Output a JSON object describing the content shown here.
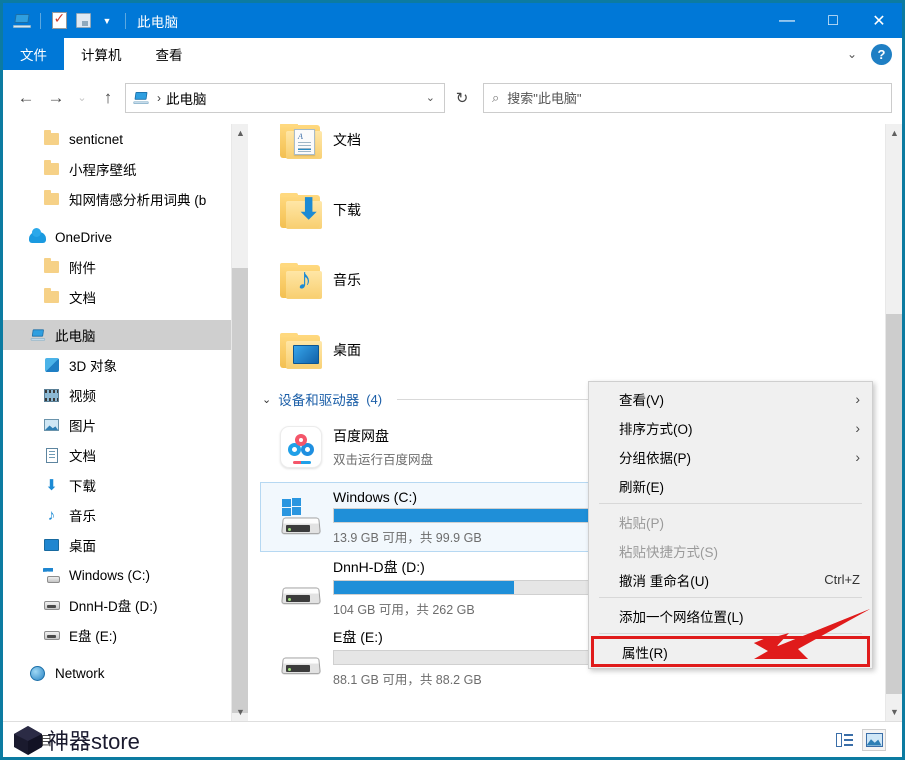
{
  "window": {
    "title": "此电脑",
    "quick_access": [
      {
        "name": "this-pc-icon",
        "label": "此电脑"
      },
      {
        "name": "properties-icon",
        "label": "属性"
      },
      {
        "name": "new-folder-icon",
        "label": "新建文件夹"
      },
      {
        "name": "customize-chevron-icon",
        "label": "自定义快速访问工具栏"
      }
    ],
    "controls": {
      "minimize": "—",
      "maximize": "□",
      "close": "✕"
    }
  },
  "ribbon": {
    "tabs": [
      {
        "label": "文件",
        "active": true
      },
      {
        "label": "计算机",
        "active": false
      },
      {
        "label": "查看",
        "active": false
      }
    ],
    "collapse_label": "⌄",
    "help_label": "?"
  },
  "navbar": {
    "back": "←",
    "forward": "→",
    "recent": "⌄",
    "up": "↑",
    "address": {
      "icon": "this-pc-icon",
      "separator": "›",
      "text": "此电脑",
      "dropdown": "⌄"
    },
    "refresh": "↻",
    "search": {
      "icon": "⌕",
      "placeholder": "搜索\"此电脑\""
    }
  },
  "sidebar": {
    "items": [
      {
        "label": "senticnet",
        "icon": "folder-icon",
        "indent": 1,
        "selected": false
      },
      {
        "label": "小程序壁纸",
        "icon": "folder-icon",
        "indent": 1,
        "selected": false
      },
      {
        "label": "知网情感分析用词典 (b",
        "icon": "folder-icon",
        "indent": 1,
        "selected": false
      },
      {
        "label": "OneDrive",
        "icon": "cloud-icon",
        "indent": 0,
        "selected": false
      },
      {
        "label": "附件",
        "icon": "folder-icon",
        "indent": 1,
        "selected": false
      },
      {
        "label": "文档",
        "icon": "folder-icon",
        "indent": 1,
        "selected": false
      },
      {
        "label": "此电脑",
        "icon": "this-pc-icon",
        "indent": 0,
        "selected": true
      },
      {
        "label": "3D 对象",
        "icon": "cube-icon",
        "indent": 1,
        "selected": false
      },
      {
        "label": "视频",
        "icon": "video-icon",
        "indent": 1,
        "selected": false
      },
      {
        "label": "图片",
        "icon": "picture-icon",
        "indent": 1,
        "selected": false
      },
      {
        "label": "文档",
        "icon": "document-icon",
        "indent": 1,
        "selected": false
      },
      {
        "label": "下载",
        "icon": "download-icon",
        "indent": 1,
        "selected": false
      },
      {
        "label": "音乐",
        "icon": "music-icon",
        "indent": 1,
        "selected": false
      },
      {
        "label": "桌面",
        "icon": "desktop-icon",
        "indent": 1,
        "selected": false
      },
      {
        "label": "Windows (C:)",
        "icon": "windows-drive-icon",
        "indent": 1,
        "selected": false
      },
      {
        "label": "DnnH-D盘 (D:)",
        "icon": "hdd-icon",
        "indent": 1,
        "selected": false
      },
      {
        "label": "E盘 (E:)",
        "icon": "hdd-icon",
        "indent": 1,
        "selected": false
      },
      {
        "label": "Network",
        "icon": "network-icon",
        "indent": 0,
        "selected": false
      }
    ]
  },
  "content": {
    "folders": [
      {
        "name": "文档",
        "badge": "document-badge"
      },
      {
        "name": "下载",
        "badge": "download-badge"
      },
      {
        "name": "音乐",
        "badge": "music-badge"
      },
      {
        "name": "桌面",
        "badge": "desktop-badge"
      }
    ],
    "drives_group": {
      "chevron": "⌄",
      "title": "设备和驱动器",
      "count": "(4)"
    },
    "drives": [
      {
        "name": "百度网盘",
        "subtitle": "双击运行百度网盘",
        "icon": "baidu-netdisk-icon",
        "has_bar": false,
        "selected": false
      },
      {
        "name": "Windows (C:)",
        "subtitle": "13.9 GB 可用，共 99.9 GB",
        "icon": "windows-drive-icon",
        "has_bar": true,
        "fill_percent": 86,
        "selected": true
      },
      {
        "name": "DnnH-D盘 (D:)",
        "subtitle": "104 GB 可用，共 262 GB",
        "icon": "hdd-icon",
        "has_bar": true,
        "fill_percent": 60,
        "selected": false
      },
      {
        "name": "E盘 (E:)",
        "subtitle": "88.1 GB 可用，共 88.2 GB",
        "icon": "hdd-icon",
        "has_bar": true,
        "fill_percent": 0,
        "selected": false
      }
    ]
  },
  "context_menu": {
    "items": [
      {
        "label": "查看(V)",
        "submenu": "›",
        "accel": "",
        "disabled": false,
        "highlight": false
      },
      {
        "label": "排序方式(O)",
        "submenu": "›",
        "accel": "",
        "disabled": false,
        "highlight": false
      },
      {
        "label": "分组依据(P)",
        "submenu": "›",
        "accel": "",
        "disabled": false,
        "highlight": false
      },
      {
        "label": "刷新(E)",
        "submenu": "",
        "accel": "",
        "disabled": false,
        "highlight": false
      },
      {
        "separator": true
      },
      {
        "label": "粘贴(P)",
        "submenu": "",
        "accel": "",
        "disabled": true,
        "highlight": false
      },
      {
        "label": "粘贴快捷方式(S)",
        "submenu": "",
        "accel": "",
        "disabled": true,
        "highlight": false
      },
      {
        "label": "撤消 重命名(U)",
        "submenu": "",
        "accel": "Ctrl+Z",
        "disabled": false,
        "highlight": false
      },
      {
        "separator": true
      },
      {
        "label": "添加一个网络位置(L)",
        "submenu": "",
        "accel": "",
        "disabled": false,
        "highlight": false
      },
      {
        "separator": true
      },
      {
        "label": "属性(R)",
        "submenu": "",
        "accel": "",
        "disabled": false,
        "highlight": true
      }
    ]
  },
  "statusbar": {
    "item_count_text": "个项目",
    "views": [
      {
        "name": "details-view-button",
        "label": "详细信息"
      },
      {
        "name": "large-icons-view-button",
        "label": "大图标"
      }
    ]
  },
  "watermark": {
    "text": "神器store"
  },
  "colors": {
    "titlebar": "#0078d7",
    "accent": "#0078d7",
    "window_border": "#0c7ba1",
    "selection": "#cfcfcf",
    "bar_fill": "#1f8fd8",
    "annotation_red": "#e01b1b",
    "group_title": "#1c5fa8"
  }
}
